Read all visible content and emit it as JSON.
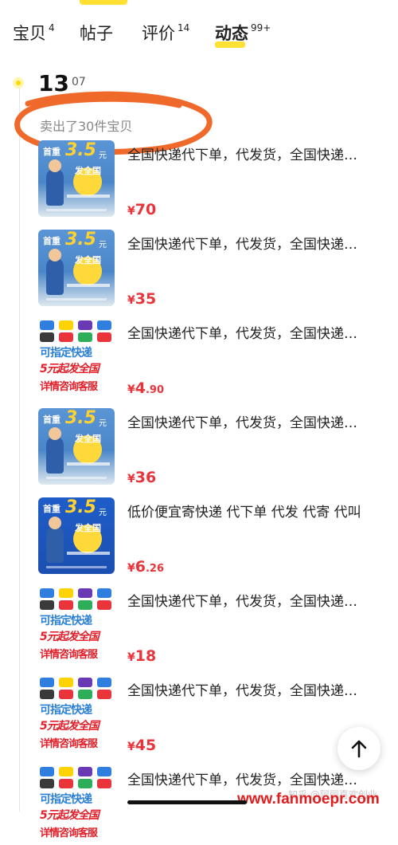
{
  "tabs": [
    {
      "label": "宝贝",
      "count": "4",
      "active": false
    },
    {
      "label": "帖子",
      "count": "",
      "active": false
    },
    {
      "label": "评价",
      "count": "14",
      "active": false
    },
    {
      "label": "动态",
      "count": "99+",
      "active": true
    }
  ],
  "timeline": {
    "date": "13",
    "date_suffix": "07",
    "sold_text": "卖出了30件宝贝"
  },
  "thumb_texts": {
    "a_head": "首重",
    "a_big": "3.5",
    "a_unit": "元",
    "a_nation": "发全国",
    "b_line1": "可指定快递",
    "b_line2": "5元起发全国",
    "b_line3": "详情咨询客服"
  },
  "items": [
    {
      "thumb": "a",
      "title": "全国快递代下单，代发货，全国快递…",
      "currency": "¥",
      "price_int": "70",
      "price_dec": ""
    },
    {
      "thumb": "a",
      "title": "全国快递代下单，代发货，全国快递…",
      "currency": "¥",
      "price_int": "35",
      "price_dec": ""
    },
    {
      "thumb": "b",
      "title": "全国快递代下单，代发货，全国快递…",
      "currency": "¥",
      "price_int": "4",
      "price_dec": ".90"
    },
    {
      "thumb": "a",
      "title": "全国快递代下单，代发货，全国快递…",
      "currency": "¥",
      "price_int": "36",
      "price_dec": ""
    },
    {
      "thumb": "c",
      "title": "低价便宜寄快递 代下单 代发 代寄 代叫",
      "currency": "¥",
      "price_int": "6",
      "price_dec": ".26"
    },
    {
      "thumb": "b",
      "title": "全国快递代下单，代发货，全国快递…",
      "currency": "¥",
      "price_int": "18",
      "price_dec": ""
    },
    {
      "thumb": "b",
      "title": "全国快递代下单，代发货，全国快递…",
      "currency": "¥",
      "price_int": "45",
      "price_dec": ""
    },
    {
      "thumb": "b",
      "title": "全国快递代下单，代发货，全国快递…",
      "currency": "¥",
      "price_int": "",
      "price_dec": ""
    }
  ],
  "watermark": "www.fanmoepr.com",
  "watermark_zhihu": "知乎 @阿丽喜欢创业",
  "colors": {
    "accent_yellow": "#ffe033",
    "price_red": "#e8343a",
    "scribble_orange": "#ef6a2a"
  },
  "icons": {
    "back_to_top": "arrow-up-icon"
  }
}
